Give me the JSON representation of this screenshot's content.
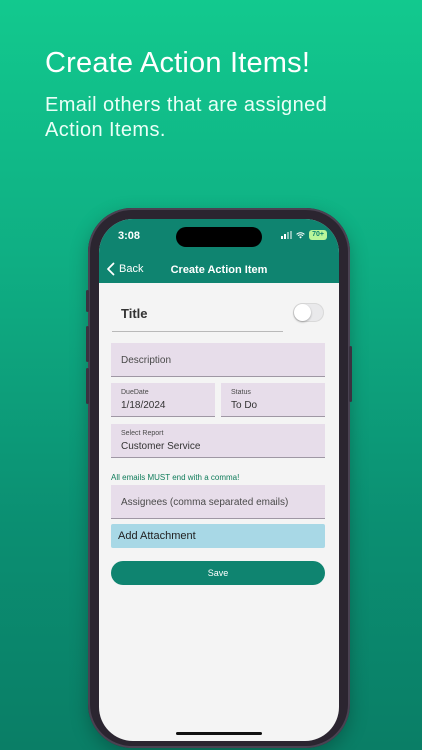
{
  "promo": {
    "headline": "Create Action Items!",
    "subline": "Email others that are assigned Action Items."
  },
  "status_bar": {
    "time": "3:08",
    "battery": "70+"
  },
  "nav": {
    "back_label": "Back",
    "title": "Create Action Item"
  },
  "form": {
    "title_label": "Title",
    "title_toggle_on": false,
    "description_placeholder": "Description",
    "due_date": {
      "label": "DueDate",
      "value": "1/18/2024"
    },
    "status": {
      "label": "Status",
      "value": "To Do"
    },
    "report": {
      "label": "Select Report",
      "value": "Customer Service"
    },
    "email_hint": "All emails MUST end with a comma!",
    "assignees_placeholder": "Assignees (comma separated emails)",
    "attachment_label": "Add Attachment",
    "save_label": "Save"
  },
  "colors": {
    "accent": "#0f8470",
    "field_bg": "#e7ddea",
    "attachment_bg": "#a8d8e6",
    "hint_text": "#0f7c5a"
  }
}
